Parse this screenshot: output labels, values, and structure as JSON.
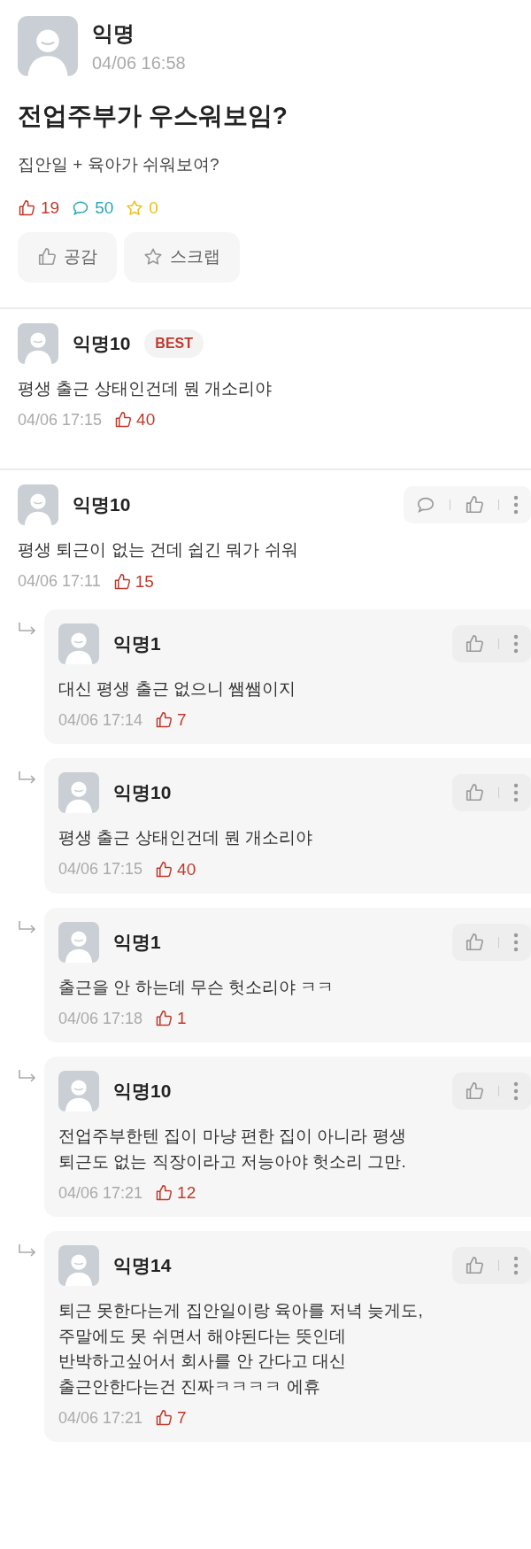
{
  "post": {
    "author": "익명",
    "time": "04/06 16:58",
    "title": "전업주부가 우스워보임?",
    "body": "집안일 + 육아가 쉬워보여?",
    "stats": {
      "likes": "19",
      "comments": "50",
      "scraps": "0"
    },
    "buttons": [
      {
        "kind": "like",
        "label": "공감"
      },
      {
        "kind": "scrap",
        "label": "스크랩"
      }
    ]
  },
  "best_comment": {
    "author": "익명10",
    "badge": "BEST",
    "text": "평생 출근 상태인건데 뭔 개소리야",
    "time": "04/06 17:15",
    "likes": "40"
  },
  "comments": [
    {
      "kind": "comment",
      "author": "익명10",
      "text": "평생 퇴근이 없는 건데 쉽긴 뭐가 쉬워",
      "time": "04/06 17:11",
      "likes": "15"
    },
    {
      "kind": "reply",
      "author": "익명1",
      "text": "대신 평생 출근 없으니 쌤쌤이지",
      "time": "04/06 17:14",
      "likes": "7"
    },
    {
      "kind": "reply",
      "author": "익명10",
      "text": "평생 출근 상태인건데 뭔 개소리야",
      "time": "04/06 17:15",
      "likes": "40"
    },
    {
      "kind": "reply",
      "author": "익명1",
      "text": "출근을 안 하는데 무슨 헛소리야 ㅋㅋ",
      "time": "04/06 17:18",
      "likes": "1"
    },
    {
      "kind": "reply",
      "author": "익명10",
      "text": "전업주부한텐 집이 마냥 편한 집이 아니라 평생\n퇴근도 없는 직장이라고 저능아야 헛소리 그만.",
      "time": "04/06 17:21",
      "likes": "12"
    },
    {
      "kind": "reply",
      "author": "익명14",
      "text": "퇴근 못한다는게 집안일이랑 육아를 저녁 늦게도,\n주말에도 못 쉬면서 해야된다는 뜻인데\n반박하고싶어서 회사를 안 간다고 대신\n출근안한다는건 진짜ㅋㅋㅋㅋ 에휴",
      "time": "04/06 17:21",
      "likes": "7"
    }
  ]
}
